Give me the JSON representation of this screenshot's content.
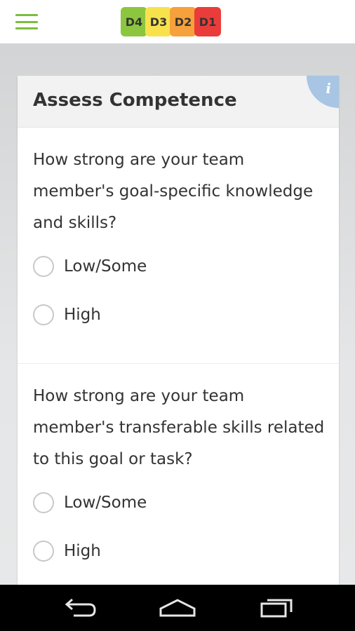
{
  "header": {
    "menu_icon": "hamburger-menu-icon",
    "logo": [
      {
        "label": "D4",
        "color": "#8cc63f"
      },
      {
        "label": "D3",
        "color": "#f7e24c"
      },
      {
        "label": "D2",
        "color": "#f7a13c"
      },
      {
        "label": "D1",
        "color": "#ea3c3a"
      }
    ],
    "accent_color": "#7cbd3d"
  },
  "card": {
    "title": "Assess Competence",
    "info_icon_glyph": "i",
    "info_icon": "info-icon"
  },
  "questions": [
    {
      "text": "How strong are your team member's goal-specific knowledge and skills?",
      "options": [
        "Low/Some",
        "High"
      ]
    },
    {
      "text": "How strong are your team member's transferable skills related to this goal or task?",
      "options": [
        "Low/Some",
        "High"
      ]
    }
  ],
  "navbar": {
    "back_icon": "back-icon",
    "home_icon": "home-icon",
    "recents_icon": "recent-apps-icon"
  }
}
